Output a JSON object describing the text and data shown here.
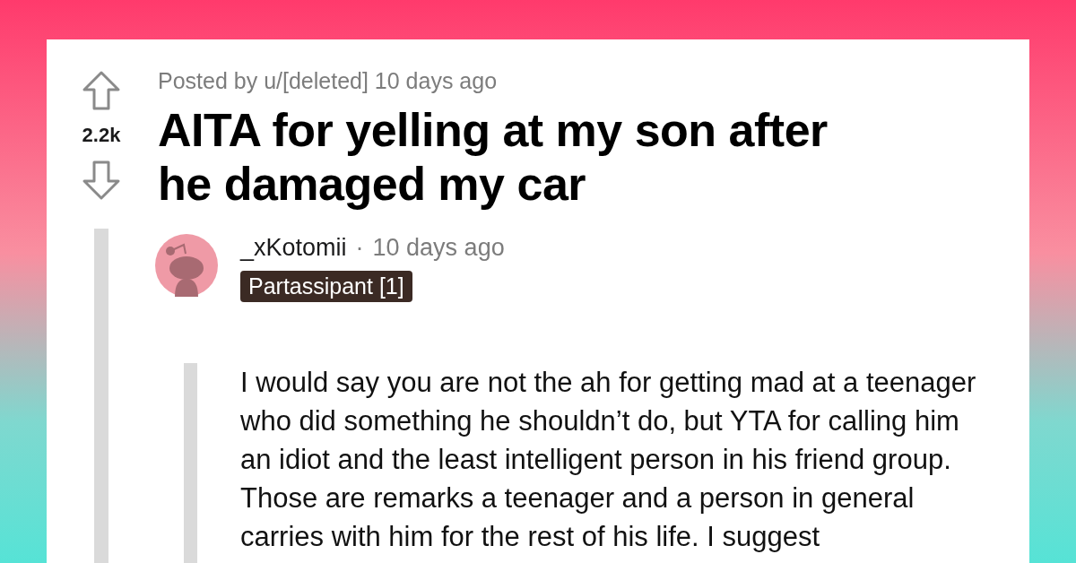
{
  "post": {
    "meta": "Posted by u/[deleted] 10 days ago",
    "votes": "2.2k",
    "title": "AITA for yelling at my son after he damaged my car"
  },
  "comment": {
    "author": "_xKotomii",
    "separator": "·",
    "time": "10 days ago",
    "flair": "Partassipant [1]",
    "body": "I would say you are not the ah for getting mad at a teenager who did something he shouldn’t do, but YTA for calling him an idiot and the least intelligent person in his friend group. Those are remarks a teenager and a person in general carries with him for the rest of his life. I suggest"
  }
}
